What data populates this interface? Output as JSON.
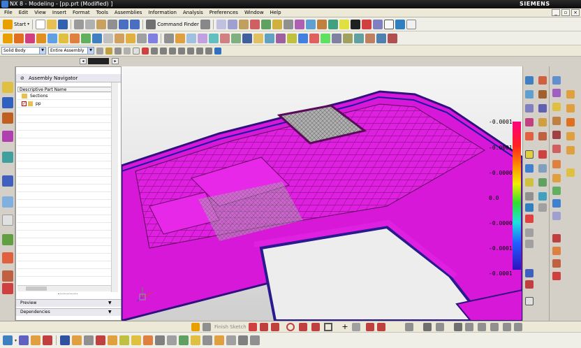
{
  "window": {
    "title": "NX 8 - Modeling - [pp.prt (Modified) ]",
    "brand": "SIEMENS"
  },
  "menu": [
    "File",
    "Edit",
    "View",
    "Insert",
    "Format",
    "Tools",
    "Assemblies",
    "Information",
    "Analysis",
    "Preferences",
    "Window",
    "Help"
  ],
  "toolbar": {
    "start_label": "Start",
    "command_finder_label": "Command Finder"
  },
  "selection": {
    "filter_value": "Solid Body",
    "scope_value": "Entire Assembly"
  },
  "navigator": {
    "title": "Assembly Navigator",
    "column_header": "Descriptive Part Name",
    "items": [
      "Sections",
      "pp"
    ],
    "sections": [
      "Preview",
      "Dependencies"
    ]
  },
  "sketch_toolbar": {
    "finish_label": "Finish Sketch"
  },
  "legend": {
    "labels": [
      "-0.0001",
      "-0.0001",
      "-0.0000",
      "0.0",
      "-0.0000",
      "-0.0001",
      "-0.0001"
    ]
  },
  "colors": {
    "accent_magenta": "#e020e0",
    "title_bar": "#111111",
    "menu_bg": "#ece9d8",
    "viewport_top": "#f6f6f6"
  }
}
